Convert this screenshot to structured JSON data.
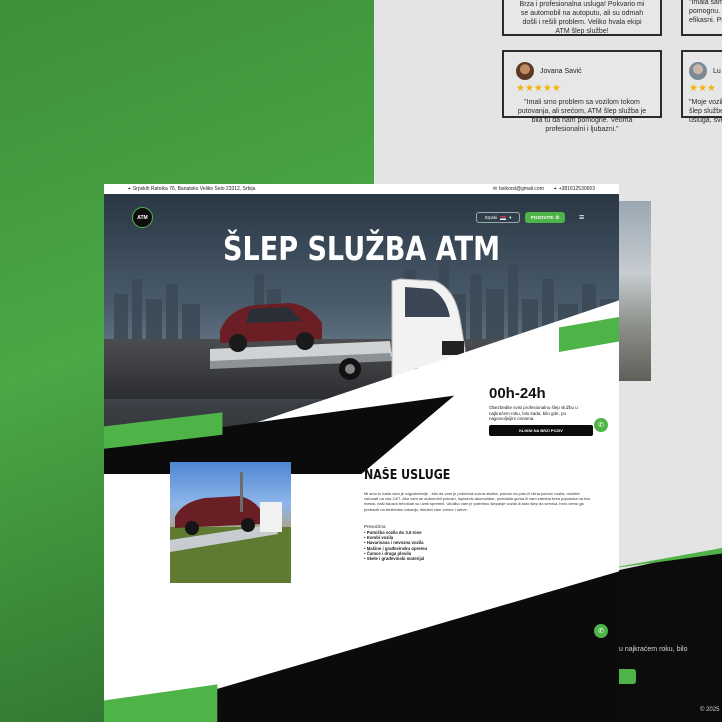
{
  "reviews": {
    "top_left_text": "Brza i profesionalna usluga! Pokvario mi se automobil na autoputu, ali su odmah došli i rešili problem. Veliko hvala ekipi ATM šlep službe!",
    "top_right_text": "\"Imala sam e pomognu. C efikasni. Pre",
    "card1": {
      "name": "Jovana Savić",
      "stars": "★★★★★",
      "text": "\"Imali smo problem sa vozilom tokom putovanja, ali srećom, ATM šlep služba je bila tu da nam pomogne. Veoma profesionalni i ljubazni.\""
    },
    "card2": {
      "name": "Lu",
      "stars": "★★★",
      "text": "\"Moje vozilo šlep službe j usluga, sve p"
    }
  },
  "site": {
    "topbar": {
      "address": "Srpskih Ratnika 76, Banatsko Veliko Selo 23312, Srbija",
      "email": "bsikorsl@gmail.com",
      "phone": "+381612530653"
    },
    "nav": {
      "logo": "ATM",
      "lang_label": "Srpski",
      "call_label": "POZOVITE",
      "menu_icon": "hamburger-icon"
    },
    "hero": {
      "title": "ŠLEP SLUŽBA ATM",
      "hours": "00h-24h",
      "hours_desc": "Obezbedite svisi profesionalnu šlep službu u najkraćem roku, bilo kada, bilo gde, po najpovoljnijim cenama.",
      "cta_label": "KLIKNI NA BRZI POZIV"
    },
    "services": {
      "title": "NAŠE USLUGE",
      "text": "Mi smo tu kada vam je najpotrebnije - bilo da vam je potrebna vučna služba, pomoć na putu ili hitna pomoć vozila, možete računati na nas 24/7. Ako vam se automobil pokvari, ispraznio akumulator, probušila guma ili vam zatreba brza popravka na licu mesta, naši iskusni tehničari su uvek spremni. Ukoliko vam je potrebno šlepanje vozila ili auto šlep do servisa, brzo ćemo ga prebaciti na bezbednu lokaciju, štedeći vam vreme i nerve.",
      "list_title": "Prevozimo:",
      "items": [
        "• Putnička vozila do 3.5 tone",
        "• Kombi vozila",
        "• Havarisana i nevozna vozila",
        "• Mašine i građevinsku opremu",
        "• Čamce i druga plovila",
        "• Skele i građevinski materijal"
      ]
    }
  },
  "background": {
    "footer_text": "u najkraćem roku, bilo",
    "copyright": "© 2025"
  },
  "colors": {
    "accent_green": "#4fb448",
    "black": "#0b0b0b",
    "star": "#f2b40a"
  }
}
